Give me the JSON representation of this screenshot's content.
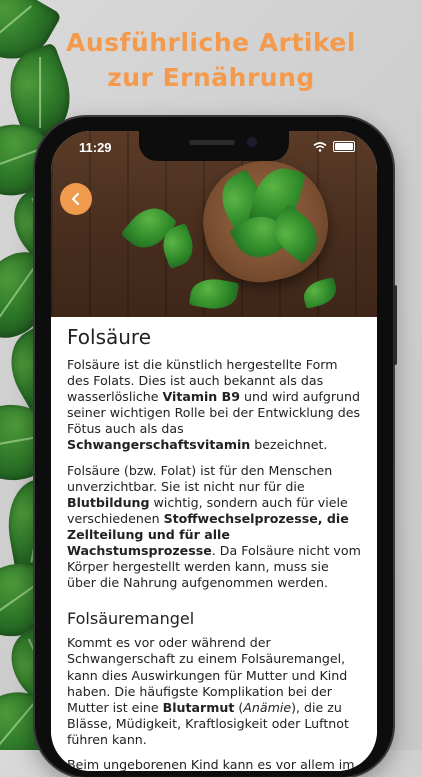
{
  "promo": {
    "headline_line1": "Ausführliche Artikel",
    "headline_line2": "zur Ernährung",
    "accent_color": "#f39a4c"
  },
  "status_bar": {
    "time": "11:29",
    "icons": [
      "wifi-icon",
      "battery-icon"
    ]
  },
  "nav": {
    "back_icon": "chevron-left-icon",
    "back_color": "#ef9a4d"
  },
  "hero": {
    "image": "spinach-heart-bowl"
  },
  "article": {
    "title": "Folsäure",
    "p1": {
      "t1": "Folsäure ist die künstlich hergestellte Form des Folats. Dies ist auch bekannt als das wasserlösliche ",
      "b1": "Vitamin B9",
      "t2": " und wird aufgrund seiner wichtigen Rolle bei der Entwicklung des Fötus auch als das ",
      "b2": "Schwangerschaftsvitamin",
      "t3": " bezeichnet."
    },
    "p2": {
      "t1": "Folsäure (bzw. Folat) ist für den Menschen unverzichtbar. Sie ist nicht nur für die ",
      "b1": "Blutbildung",
      "t2": " wichtig, sondern auch für viele verschiedenen ",
      "b2": "Stoffwechselprozesse, die Zellteilung und für alle Wachstumsprozesse",
      "t3": ". Da Folsäure nicht vom Körper hergestellt werden kann, muss sie über die Nahrung aufgenommen werden."
    },
    "section2_title": "Folsäuremangel",
    "p3": {
      "t1": "Kommt es vor oder während der Schwangerschaft zu einem Folsäuremangel, kann dies Auswirkungen für Mutter und Kind haben. Die häufigste Komplikation bei der Mutter ist eine ",
      "b1": "Blutarmut",
      "t2": " (",
      "i1": "Anämie",
      "t3": "), die zu Blässe, Müdigkeit, Kraftlosigkeit oder Luftnot führen kann."
    },
    "p4": {
      "t1": "Beim ungeborenen Kind kann es vor allem im"
    }
  }
}
